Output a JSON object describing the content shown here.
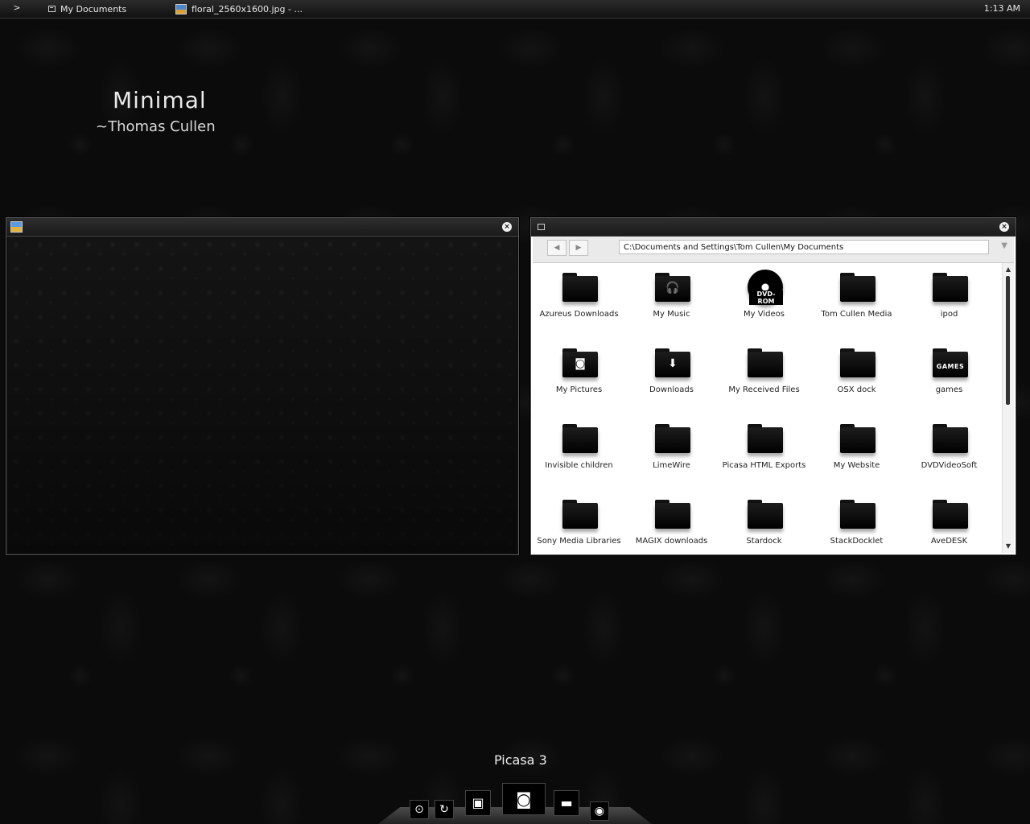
{
  "taskbar": {
    "chevron": ">",
    "tasks": [
      {
        "label": "My Documents",
        "icon": "folder-window-icon"
      },
      {
        "label": "floral_2560x1600.jpg - ...",
        "icon": "image-file-icon"
      }
    ],
    "clock": "1:13 AM"
  },
  "desktop": {
    "title": "Minimal",
    "subtitle": "~Thomas Cullen"
  },
  "picture_window": {
    "icon": "image-file-icon",
    "close": "×"
  },
  "explorer": {
    "close": "×",
    "back": "◀",
    "forward": "▶",
    "address": "C:\\Documents and Settings\\Tom Cullen\\My Documents",
    "address_dropdown": "▼",
    "scroll_up": "▲",
    "scroll_down": "▼",
    "items": [
      {
        "label": "Azureus Downloads",
        "icon": "folder-icon",
        "glyph": ""
      },
      {
        "label": "My Music",
        "icon": "headphones-folder-icon",
        "glyph": "🎧"
      },
      {
        "label": "My Videos",
        "icon": "dvd-disc-icon",
        "glyph": "DVD-ROM"
      },
      {
        "label": "Tom Cullen Media",
        "icon": "folder-icon",
        "glyph": ""
      },
      {
        "label": "ipod",
        "icon": "folder-icon",
        "glyph": ""
      },
      {
        "label": "My Pictures",
        "icon": "camera-folder-icon",
        "glyph": "◙"
      },
      {
        "label": "Downloads",
        "icon": "download-folder-icon",
        "glyph": "⬇"
      },
      {
        "label": "My Received Files",
        "icon": "folder-icon",
        "glyph": ""
      },
      {
        "label": "OSX dock",
        "icon": "folder-icon",
        "glyph": ""
      },
      {
        "label": "games",
        "icon": "games-folder-icon",
        "glyph": "GAMES"
      },
      {
        "label": "Invisible children",
        "icon": "folder-icon",
        "glyph": ""
      },
      {
        "label": "LimeWire",
        "icon": "folder-icon",
        "glyph": ""
      },
      {
        "label": "Picasa HTML Exports",
        "icon": "folder-icon",
        "glyph": ""
      },
      {
        "label": "My Website",
        "icon": "folder-icon",
        "glyph": ""
      },
      {
        "label": "DVDVideoSoft",
        "icon": "folder-icon",
        "glyph": ""
      },
      {
        "label": "Sony Media Libraries",
        "icon": "folder-icon",
        "glyph": ""
      },
      {
        "label": "MAGIX downloads",
        "icon": "folder-icon",
        "glyph": ""
      },
      {
        "label": "Stardock",
        "icon": "folder-icon",
        "glyph": ""
      },
      {
        "label": "StackDocklet",
        "icon": "folder-icon",
        "glyph": ""
      },
      {
        "label": "AveDESK",
        "icon": "folder-icon",
        "glyph": ""
      }
    ]
  },
  "dock": {
    "label": "Picasa 3",
    "icons": [
      {
        "name": "disc-icon",
        "glyph": "⊙"
      },
      {
        "name": "refresh-icon",
        "glyph": "↻"
      },
      {
        "name": "picture-icon",
        "glyph": "▣"
      },
      {
        "name": "camera-icon",
        "glyph": "◙"
      },
      {
        "name": "clapperboard-icon",
        "glyph": "▬"
      },
      {
        "name": "cd-icon",
        "glyph": "◉"
      }
    ]
  }
}
